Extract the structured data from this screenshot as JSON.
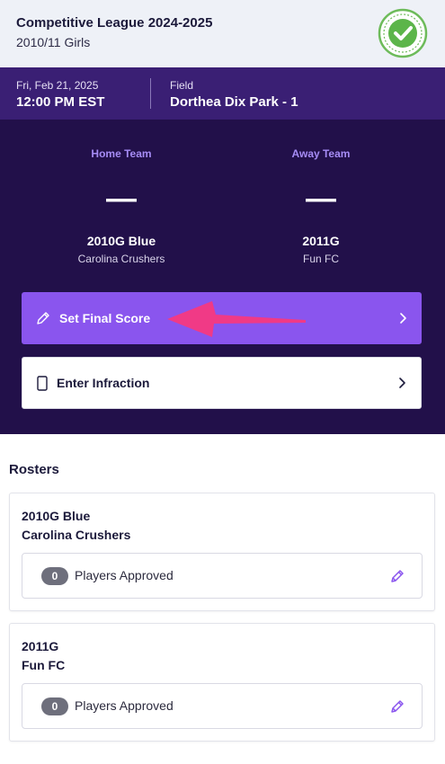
{
  "header": {
    "title": "Competitive League 2024-2025",
    "subtitle": "2010/11 Girls"
  },
  "info": {
    "date": "Fri, Feb 21, 2025",
    "time": "12:00 PM EST",
    "field_label": "Field",
    "field_value": "Dorthea Dix Park - 1"
  },
  "match": {
    "home": {
      "side": "Home Team",
      "score": "—",
      "name": "2010G Blue",
      "club": "Carolina Crushers"
    },
    "away": {
      "side": "Away Team",
      "score": "—",
      "name": "2011G",
      "club": "Fun FC"
    }
  },
  "actions": {
    "final_score": "Set Final Score",
    "infraction": "Enter Infraction"
  },
  "rosters": {
    "title": "Rosters",
    "items": [
      {
        "team": "2010G Blue",
        "club": "Carolina Crushers",
        "count": "0",
        "status": "Players Approved"
      },
      {
        "team": "2011G",
        "club": "Fun FC",
        "count": "0",
        "status": "Players Approved"
      }
    ]
  },
  "icons": {
    "logo": "approved-check-seal-icon",
    "final_score": "pencil-icon",
    "infraction": "phone-card-icon",
    "chevron": "chevron-right-icon",
    "edit": "edit-pencil-icon"
  },
  "colors": {
    "accent": "#8a55ee",
    "dark_panel": "#22104a",
    "info_bar": "#3a1f74",
    "annotation_arrow": "#f03a86"
  }
}
